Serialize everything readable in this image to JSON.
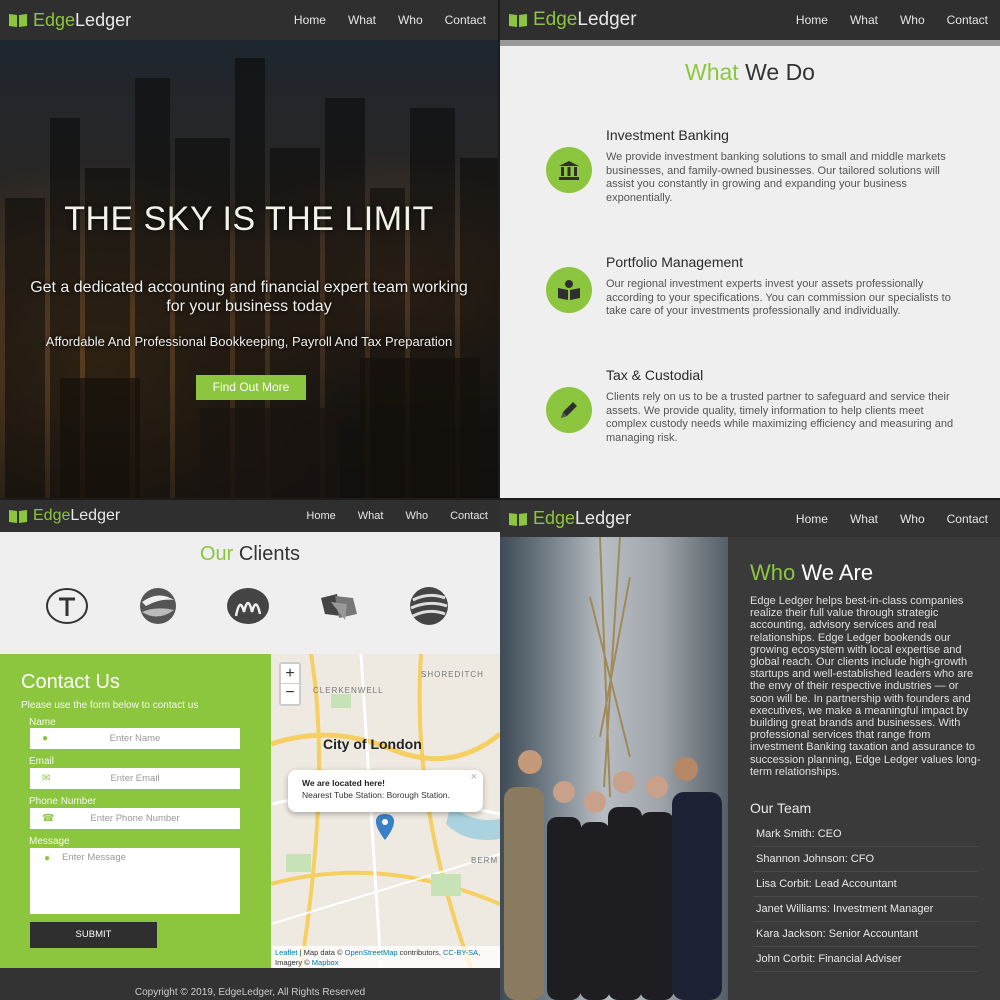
{
  "brand": {
    "part1": "Edge",
    "part2": "Ledger"
  },
  "nav": [
    "Home",
    "What",
    "Who",
    "Contact"
  ],
  "hero": {
    "title": "THE SKY IS THE LIMIT",
    "subtitle": "Get a dedicated accounting and financial expert team working for your business today",
    "tagline": "Affordable And Professional Bookkeeping, Payroll And Tax Preparation",
    "button": "Find Out More"
  },
  "what": {
    "title_accent": "What",
    "title_rest": " We Do",
    "services": [
      {
        "icon": "bank-icon",
        "title": "Investment Banking",
        "text": "We provide investment banking solutions to small and middle markets businesses, and family-owned businesses. Our tailored solutions will assist you constantly in growing and expanding your business exponentially."
      },
      {
        "icon": "book-icon",
        "title": "Portfolio Management",
        "text": "Our regional investment experts invest your assets professionally according to your specifications. You can commission our specialists to take care of your investments professionally and individually."
      },
      {
        "icon": "pencil-icon",
        "title": "Tax & Custodial",
        "text": "Clients rely on us to be a trusted partner to safeguard and service their assets. We provide quality, timely information to help clients meet complex custody needs while maximizing efficiency and measuring and managing risk."
      }
    ]
  },
  "clients": {
    "title_accent": "Our",
    "title_rest": " Clients"
  },
  "contact": {
    "title": "Contact Us",
    "hint": "Please use the form below to contact us",
    "name_label": "Name",
    "name_ph": "Enter Name",
    "email_label": "Email",
    "email_ph": "Enter Email",
    "phone_label": "Phone Number",
    "phone_ph": "Enter Phone Number",
    "message_label": "Message",
    "message_ph": "Enter Message",
    "submit": "SUBMIT"
  },
  "map": {
    "zoom_in": "+",
    "zoom_out": "−",
    "city": "City of London",
    "area1": "SHOREDITCH",
    "area2": "CLERKENWELL",
    "area3": "BERM",
    "popup_title": "We are located here!",
    "popup_text": "Nearest Tube Station: Borough Station.",
    "popup_close": "×",
    "attribution_leaflet": "Leaflet",
    "attribution_mid": " | Map data © ",
    "attribution_osm": "OpenStreetMap",
    "attribution_rest": " contributors, ",
    "attribution_cc": "CC-BY-SA",
    "attribution_imagery": ", Imagery © ",
    "attribution_mapbox": "Mapbox"
  },
  "footer": "Copyright © 2019, EdgeLedger, All Rights Reserved",
  "who": {
    "title_accent": "Who",
    "title_rest": " We Are",
    "text": "Edge Ledger helps best-in-class companies realize their full value through strategic accounting, advisory services and real relationships. Edge Ledger bookends our growing ecosystem with local expertise and global reach. Our clients include high-growth startups and well-established leaders who are the envy of their respective industries — or soon will be. In partnership with founders and executives, we make a meaningful impact by building great brands and businesses. With professional services that range from investment Banking taxation and assurance to succession planning, Edge Ledger values long-term relationships.",
    "team_heading": "Our Team",
    "team": [
      "Mark Smith: CEO",
      "Shannon Johnson: CFO",
      "Lisa Corbit: Lead Accountant",
      "Janet Williams: Investment Manager",
      "Kara Jackson: Senior Accountant",
      "John Corbit: Financial Adviser"
    ]
  },
  "colors": {
    "accent": "#8cc63f",
    "dark": "#2f2f2f"
  }
}
